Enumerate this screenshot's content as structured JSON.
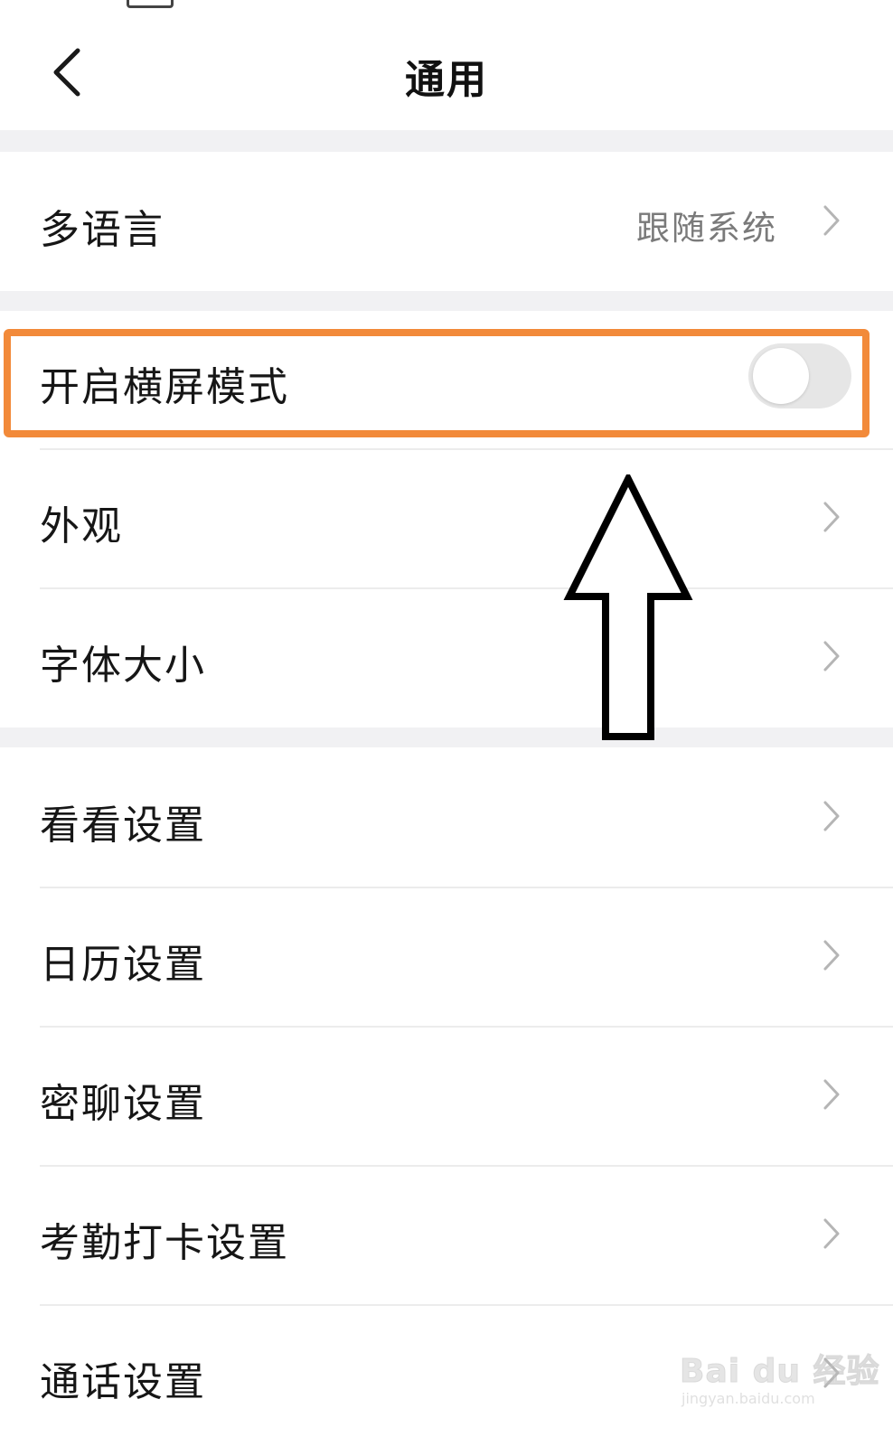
{
  "header": {
    "title": "通用"
  },
  "rows": [
    {
      "label": "多语言",
      "value": "跟随系统",
      "has_chevron": true
    },
    {
      "label": "开启横屏模式",
      "toggle": {
        "on": false
      }
    },
    {
      "label": "外观",
      "has_chevron": true
    },
    {
      "label": "字体大小",
      "has_chevron": true
    },
    {
      "label": "看看设置",
      "has_chevron": true
    },
    {
      "label": "日历设置",
      "has_chevron": true
    },
    {
      "label": "密聊设置",
      "has_chevron": true
    },
    {
      "label": "考勤打卡设置",
      "has_chevron": true
    },
    {
      "label": "通话设置",
      "has_chevron": true
    }
  ],
  "annotation": {
    "highlight_color": "#f28a3a",
    "arrow": "up-arrow-outline"
  },
  "watermark": {
    "logo_text": "Bai du 经验",
    "url": "jingyan.baidu.com"
  },
  "colors": {
    "background": "#ffffff",
    "section_gap": "#f1f1f3",
    "toggle_off": "#e6e6e6",
    "secondary_text": "#7a7a7a"
  },
  "icons": {
    "back": "back-chevron-icon",
    "row_chevron": "chevron-right-icon"
  }
}
